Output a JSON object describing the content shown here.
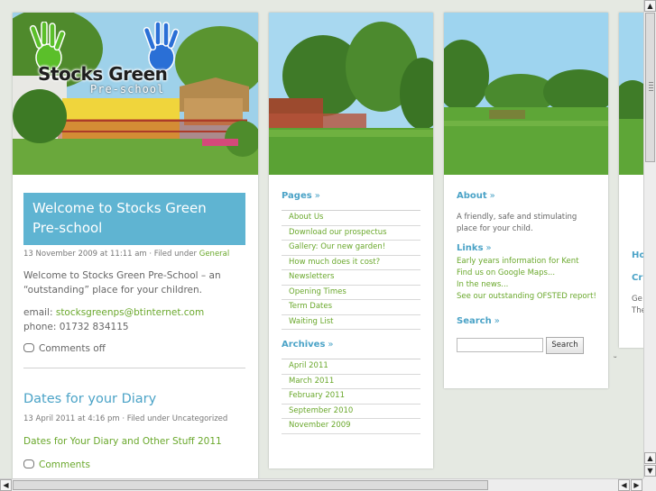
{
  "logo": {
    "name": "Stocks Green",
    "tagline": "Pre-school"
  },
  "post1": {
    "title": "Welcome to Stocks Green Pre-school",
    "meta_date": "13 November 2009 at 11:11 am · Filed under ",
    "meta_category": "General",
    "intro": "Welcome to Stocks Green Pre-School – an “outstanding” place for your children.",
    "email_label": "email: ",
    "email": "stocksgreenps@btinternet.com",
    "phone": "phone: 01732 834115",
    "comments": "Comments off"
  },
  "post2": {
    "title": "Dates for your Diary",
    "meta": "13 April 2011 at 4:16 pm · Filed under Uncategorized",
    "link": "Dates for Your Diary and Other Stuff 2011",
    "comments": "Comments"
  },
  "pages": {
    "heading": "Pages",
    "raquo": "»",
    "items": [
      "About Us",
      "Download our prospectus",
      "Gallery: Our new garden!",
      "How much does it cost?",
      "Newsletters",
      "Opening Times",
      "Term Dates",
      "Waiting List"
    ]
  },
  "archives": {
    "heading": "Archives",
    "raquo": "»",
    "items": [
      "April 2011",
      "March 2011",
      "February 2011",
      "September 2010",
      "November 2009"
    ]
  },
  "about": {
    "heading": "About",
    "raquo": "»",
    "text": "A friendly, safe and stimulating place for your child."
  },
  "links": {
    "heading": "Links",
    "raquo": "»",
    "items": [
      "Early years information for Kent",
      "Find us on Google Maps...",
      "In the news...",
      "See our outstanding OFSTED report!"
    ]
  },
  "search": {
    "heading": "Search",
    "raquo": "»",
    "button": "Search",
    "value": ""
  },
  "partial": {
    "heading_fragment": "Ho",
    "title_fragment": "Cr",
    "line1": "Ge",
    "line2": "The"
  },
  "scroll": {
    "up": "▲",
    "down": "▼",
    "left": "◀",
    "right": "▶"
  },
  "colors": {
    "accent_blue": "#4ba3c7",
    "title_box": "#5fb4d2",
    "link_green": "#6aa82c",
    "background": "#e5e9e2"
  }
}
